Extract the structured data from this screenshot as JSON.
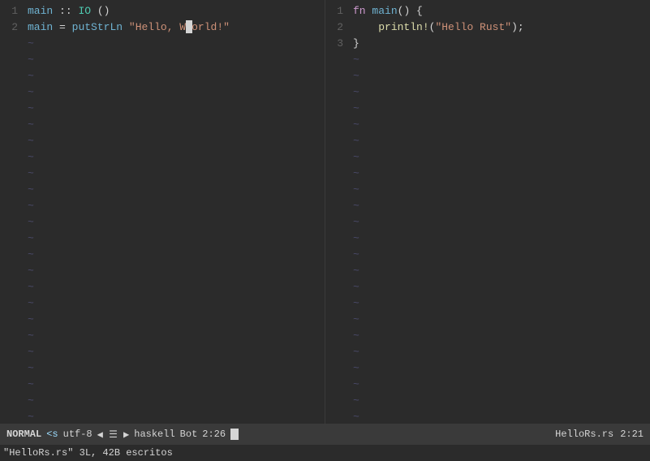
{
  "editor": {
    "pane_left": {
      "lines": [
        {
          "num": "1",
          "code": "main :: IO ()"
        },
        {
          "num": "2",
          "code": "main = putStrLn \"Hello, World!\""
        }
      ]
    },
    "pane_right": {
      "lines": [
        {
          "num": "1",
          "code": "fn main() {"
        },
        {
          "num": "2",
          "code": "    println!(\"Hello Rust\");"
        },
        {
          "num": "3",
          "code": "}"
        }
      ]
    }
  },
  "statusbar": {
    "mode": "NORMAL",
    "tag": "<s",
    "encoding": "utf-8",
    "arrows": "◀ ☰ ▶",
    "filetype": "haskell",
    "bot": "Bot",
    "position": "2:26",
    "filename_right": "HelloRs.rs",
    "col_right": "2:21"
  },
  "cmdline": {
    "text": "\"HelloRs.rs\" 3L, 42B escritos"
  }
}
